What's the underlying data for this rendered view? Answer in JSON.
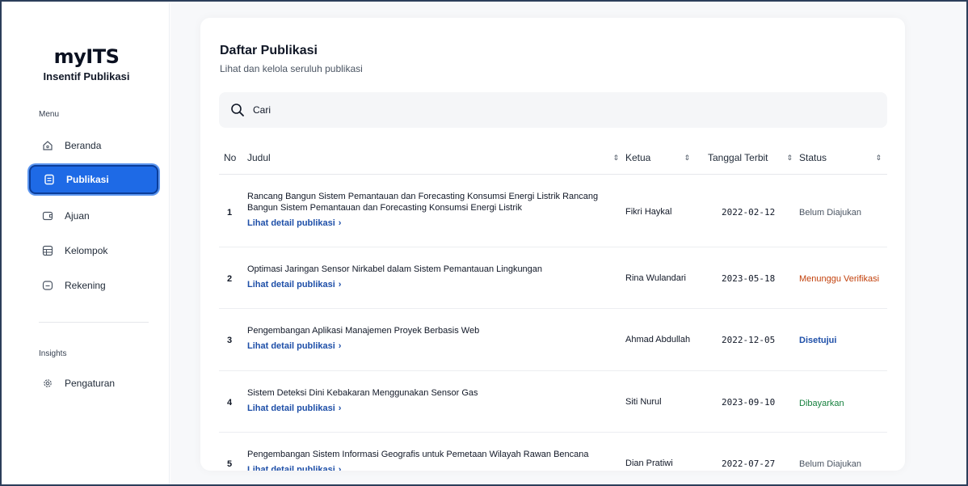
{
  "app": {
    "logo": "myITS",
    "subtitle": "Insentif Publikasi"
  },
  "sidebar": {
    "menu_label": "Menu",
    "items": [
      {
        "label": "Beranda",
        "icon": "home-icon"
      },
      {
        "label": "Publikasi",
        "icon": "document-icon",
        "active": true
      },
      {
        "label": "Ajuan",
        "icon": "ticket-icon"
      },
      {
        "label": "Kelompok",
        "icon": "table-icon"
      },
      {
        "label": "Rekening",
        "icon": "wallet-icon"
      }
    ],
    "insights_label": "Insights",
    "settings": {
      "label": "Pengaturan",
      "icon": "gear-icon"
    }
  },
  "main": {
    "title": "Daftar Publikasi",
    "subtitle": "Lihat dan kelola seruluh publikasi",
    "search": {
      "placeholder": "Cari",
      "value": ""
    },
    "table": {
      "columns": {
        "no": "No",
        "judul": "Judul",
        "ketua": "Ketua",
        "tanggal": "Tanggal Terbit",
        "status": "Status"
      },
      "detail_link_label": "Lihat detail publikasi",
      "rows": [
        {
          "no": "1",
          "title": "Rancang Bangun Sistem Pemantauan dan Forecasting Konsumsi Energi Listrik Rancang Bangun Sistem Pemantauan dan Forecasting Konsumsi Energi Listrik",
          "ketua": "Fikri Haykal",
          "tanggal": "2022-02-12",
          "status": "Belum Diajukan"
        },
        {
          "no": "2",
          "title": "Optimasi Jaringan Sensor Nirkabel dalam Sistem Pemantauan Lingkungan",
          "ketua": "Rina Wulandari",
          "tanggal": "2023-05-18",
          "status": "Menunggu Verifikasi"
        },
        {
          "no": "3",
          "title": "Pengembangan Aplikasi Manajemen Proyek Berbasis Web",
          "ketua": "Ahmad Abdullah",
          "tanggal": "2022-12-05",
          "status": "Disetujui"
        },
        {
          "no": "4",
          "title": "Sistem Deteksi Dini Kebakaran Menggunakan Sensor Gas",
          "ketua": "Siti Nurul",
          "tanggal": "2023-09-10",
          "status": "Dibayarkan"
        },
        {
          "no": "5",
          "title": "Pengembangan Sistem Informasi Geografis untuk Pemetaan Wilayah Rawan Bencana",
          "ketua": "Dian Pratiwi",
          "tanggal": "2022-07-27",
          "status": "Belum Diajukan"
        }
      ]
    }
  },
  "colors": {
    "accent": "#1e6ae6",
    "link": "#1e4fa8",
    "status_pending": "#c2410c",
    "status_paid": "#15803d"
  }
}
